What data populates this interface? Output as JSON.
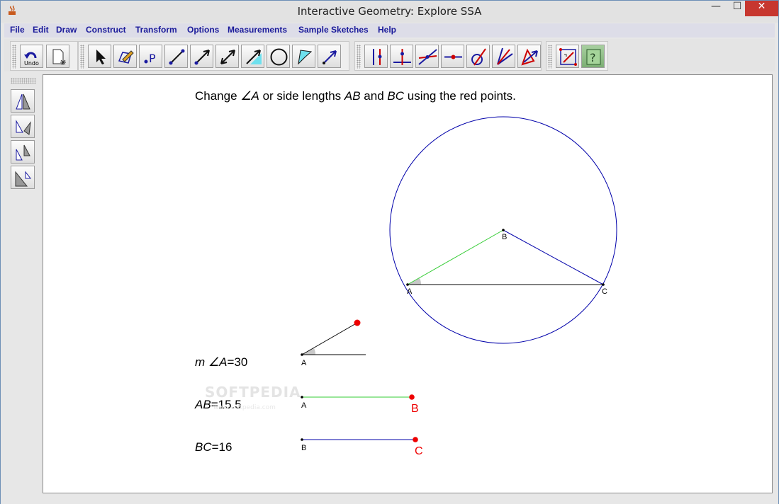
{
  "window": {
    "title": "Interactive Geometry: Explore SSA",
    "controls": {
      "minimize": "—",
      "maximize": "☐",
      "close": "✕"
    }
  },
  "menu": [
    "File",
    "Edit",
    "Draw",
    "Construct",
    "Transform",
    "Options",
    "Measurements",
    "Sample Sketches",
    "Help"
  ],
  "toolbar": {
    "undo_label": "Undo",
    "tools": [
      "new-sketch",
      "select-arrow",
      "freehand-pencil",
      "point",
      "segment",
      "ray",
      "line",
      "vector",
      "circle",
      "polygon",
      "vector-arrow",
      "perpendicular",
      "parallel",
      "intersection",
      "midpoint",
      "compass",
      "angle-bisector",
      "reflect",
      "locus",
      "help"
    ]
  },
  "sidebar": {
    "tools": [
      "reflection-transform",
      "rotation-transform",
      "translation-transform",
      "dilation-transform"
    ]
  },
  "sketch": {
    "instruction_prefix": "Change ",
    "instruction_angle": "∠A",
    "instruction_mid": " or side lengths ",
    "instruction_ab": "AB",
    "instruction_and": " and ",
    "instruction_bc": "BC",
    "instruction_suffix": " using the red points.",
    "measure_angle_m": "m",
    "measure_angle_name": "∠A",
    "measure_angle_value": "=30",
    "measure_ab_name": "AB",
    "measure_ab_value": "=15.5",
    "measure_bc_name": "BC",
    "measure_bc_value": "=16",
    "points": {
      "A": "A",
      "B": "B",
      "C": "C"
    },
    "red_labels": {
      "B": "B",
      "C": "C"
    },
    "colors": {
      "circle": "#0000aa",
      "side_ab": "#33cc33",
      "side_bc": "#0000aa",
      "handle": "#ee0000"
    }
  },
  "watermark": {
    "main": "SOFTPEDIA",
    "sub": "www.softpedia.com"
  }
}
